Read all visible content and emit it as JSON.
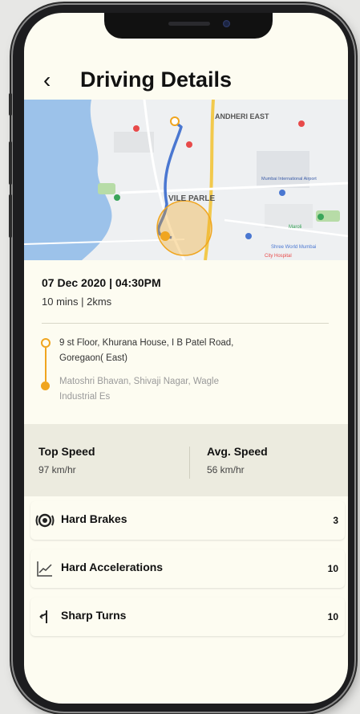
{
  "header": {
    "back_label": "‹",
    "title": "Driving Details"
  },
  "map": {
    "labels": {
      "area_top": "ANDHERI EAST",
      "area_mid": "VILE PARLE",
      "airport": "Mumbai International Airport",
      "park": "Maroli",
      "stadium": "Shree World Mumbai",
      "hotel": "City Hospital"
    },
    "accent_route": "#4a77d1",
    "accent_orange": "#f0a51f",
    "accent_yellow": "#f2c94c"
  },
  "trip": {
    "date_time": "07 Dec 2020 | 04:30PM",
    "duration_distance": "10 mins | 2kms",
    "start_address": "9 st Floor, Khurana House, I B Patel Road, Goregaon( East)",
    "end_address": "Matoshri Bhavan, Shivaji Nagar, Wagle Industrial Es"
  },
  "speed": {
    "top_label": "Top Speed",
    "top_value": "97  km/hr",
    "avg_label": "Avg. Speed",
    "avg_value": "56 km/hr"
  },
  "events": [
    {
      "icon": "brake-icon",
      "label": "Hard Brakes",
      "count": "3"
    },
    {
      "icon": "acceleration-icon",
      "label": "Hard Accelerations",
      "count": "10"
    },
    {
      "icon": "turn-icon",
      "label": "Sharp Turns",
      "count": "10"
    }
  ]
}
